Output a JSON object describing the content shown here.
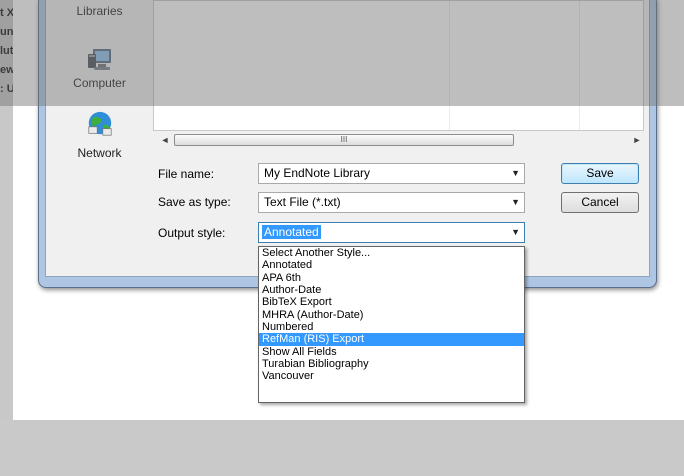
{
  "background": {
    "left_text_fragments": [
      "t X",
      "un's",
      "luto",
      "ew H",
      ": Usi"
    ]
  },
  "nav_pane": {
    "items": [
      {
        "label": "Libraries",
        "icon": "libraries-icon"
      },
      {
        "label": "Computer",
        "icon": "computer-icon"
      },
      {
        "label": "Network",
        "icon": "network-icon"
      }
    ]
  },
  "file_list": {
    "scrollbar_thumb_glyph": "III",
    "scroll_left_glyph": "◄",
    "scroll_right_glyph": "►"
  },
  "form": {
    "file_name_label": "File name:",
    "file_name_value": "My EndNote Library",
    "save_as_type_label": "Save as type:",
    "save_as_type_value": "Text File (*.txt)",
    "output_style_label": "Output style:",
    "output_style_value": "Annotated",
    "dropdown_arrow": "▼"
  },
  "buttons": {
    "save": "Save",
    "cancel": "Cancel"
  },
  "output_style_options": [
    "Select Another Style...",
    "Annotated",
    "APA 6th",
    "Author-Date",
    "BibTeX Export",
    "MHRA (Author-Date)",
    "Numbered",
    "RefMan (RIS) Export",
    "Show All Fields",
    "Turabian Bibliography",
    "Vancouver"
  ],
  "highlighted_option": "RefMan (RIS) Export",
  "colors": {
    "selection": "#3399ff",
    "dialog_frame": "#aec6e3",
    "dialog_client": "#f0f0f0"
  }
}
